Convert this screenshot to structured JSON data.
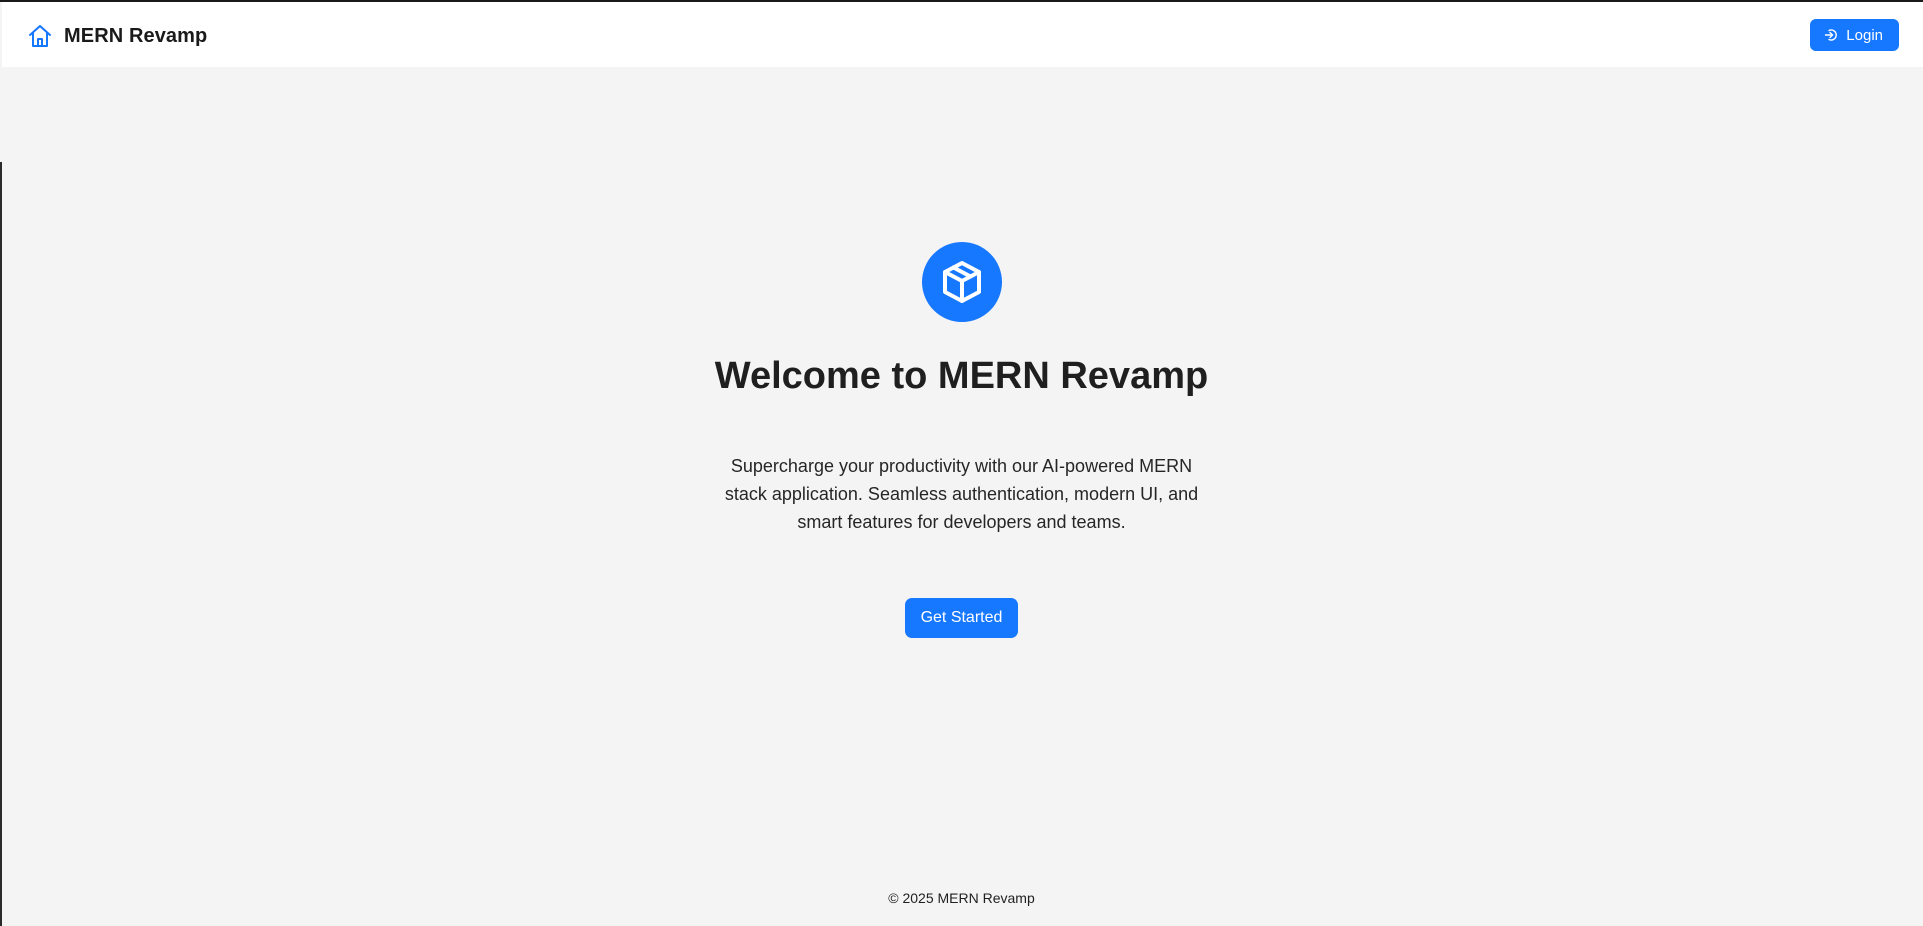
{
  "header": {
    "brand_name": "MERN Revamp",
    "brand_icon": "home-icon",
    "login_label": "Login",
    "login_icon": "login-icon"
  },
  "hero": {
    "logo_icon": "cube-icon",
    "title": "Welcome to MERN Revamp",
    "description": "Supercharge your productivity with our AI-powered MERN stack application. Seamless authentication, modern UI, and smart features for developers and teams.",
    "cta_label": "Get Started"
  },
  "footer": {
    "copyright": "© 2025 MERN Revamp"
  },
  "colors": {
    "accent": "#1677ff",
    "background": "#f4f4f4",
    "header_background": "#ffffff"
  }
}
